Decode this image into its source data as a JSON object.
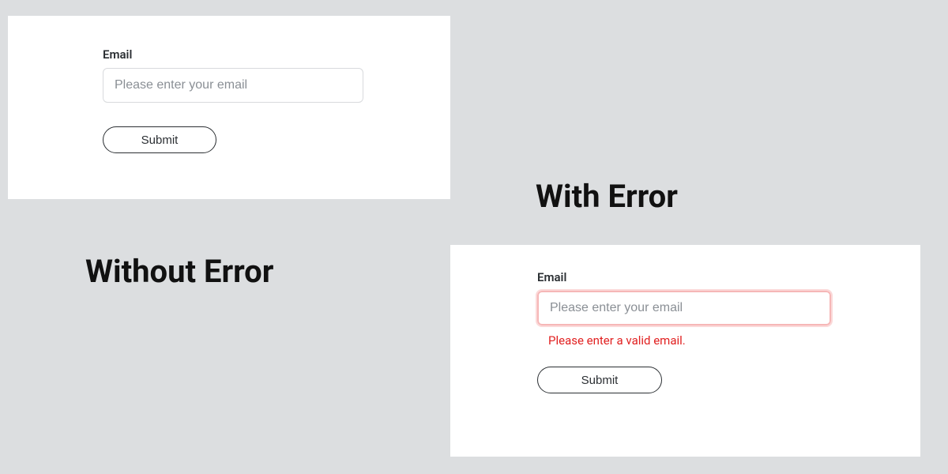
{
  "headings": {
    "without_error": "Without Error",
    "with_error": "With Error"
  },
  "form_without_error": {
    "email_label": "Email",
    "email_placeholder": "Please enter your email",
    "email_value": "",
    "submit_label": "Submit"
  },
  "form_with_error": {
    "email_label": "Email",
    "email_placeholder": "Please enter your email",
    "email_value": "",
    "error_message": "Please enter a valid email.",
    "submit_label": "Submit"
  },
  "colors": {
    "page_bg": "#dcdee0",
    "panel_bg": "#ffffff",
    "label_text": "#2b2f33",
    "placeholder": "#8a8f95",
    "input_border": "#d8dadd",
    "error_border": "#f6b7b7",
    "error_text": "#e12020"
  }
}
